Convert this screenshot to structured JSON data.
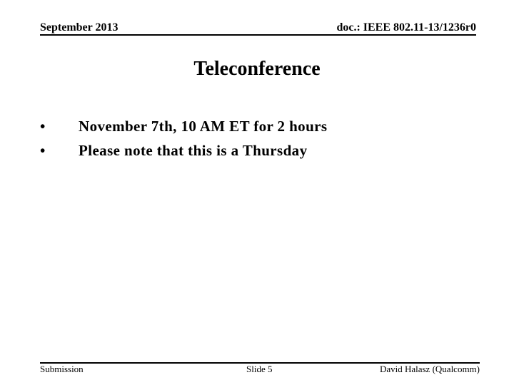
{
  "header": {
    "date": "September 2013",
    "doc_id": "doc.: IEEE 802.11-13/1236r0"
  },
  "slide": {
    "title": "Teleconference",
    "bullets": [
      {
        "marker": "•",
        "text": "November 7th, 10 AM ET for 2 hours"
      },
      {
        "marker": "•",
        "text": "Please note that this is a Thursday"
      }
    ]
  },
  "footer": {
    "left": "Submission",
    "center": "Slide 5",
    "right": "David Halasz (Qualcomm)"
  }
}
